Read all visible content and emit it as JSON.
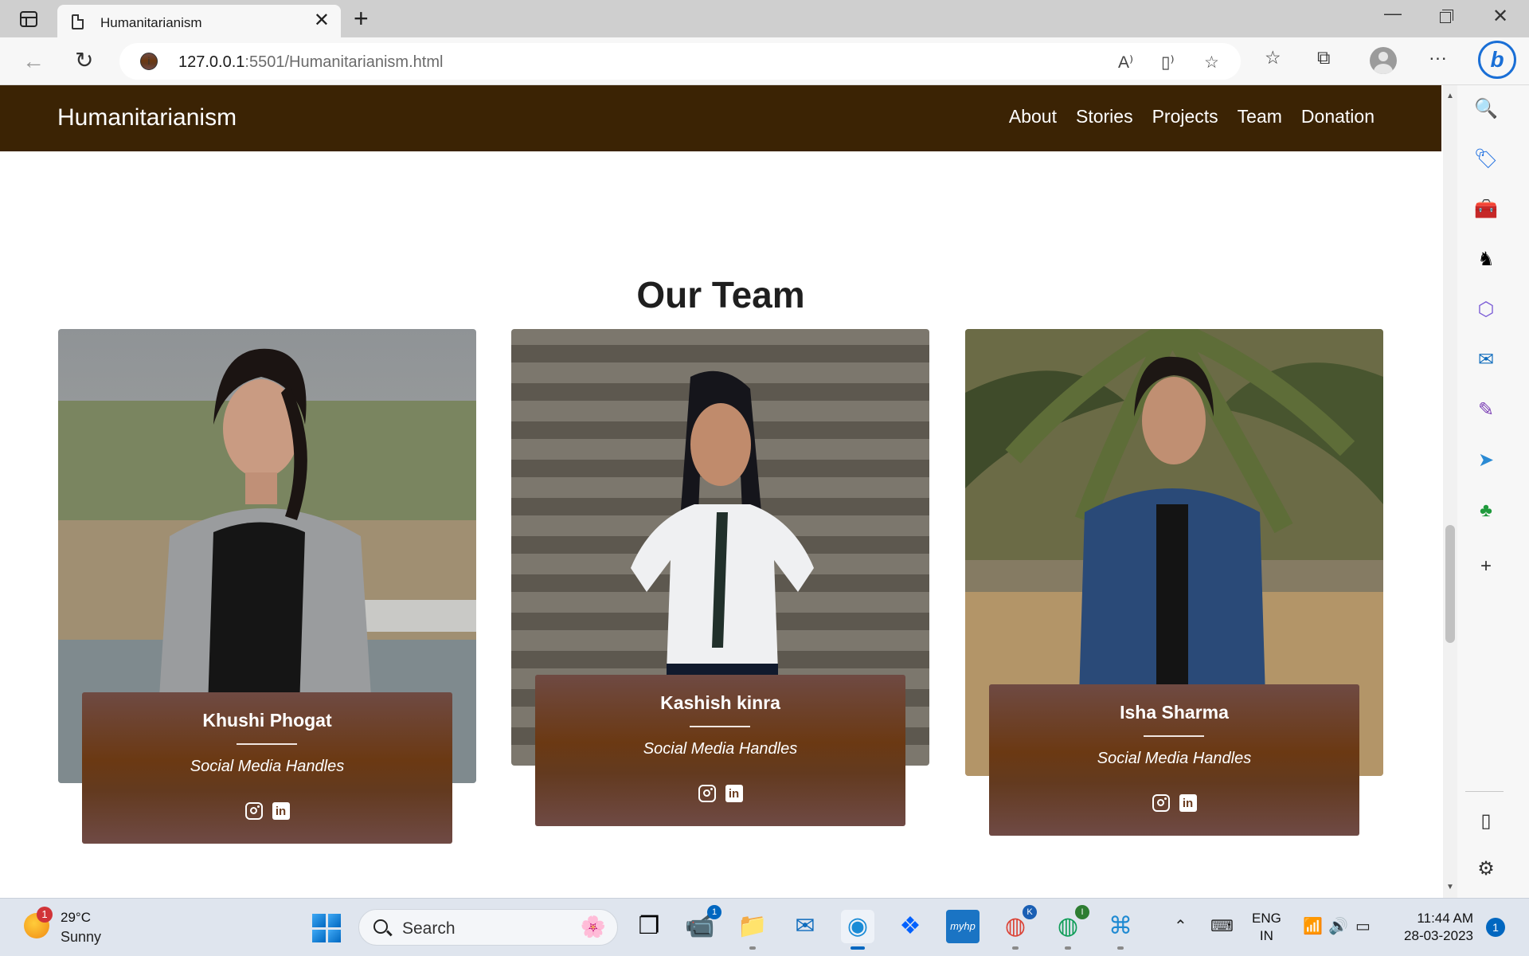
{
  "browser": {
    "tab_title": "Humanitarianism",
    "url_host": "127.0.0.1",
    "url_rest": ":5501/Humanitarianism.html"
  },
  "site": {
    "brand": "Humanitarianism",
    "nav": [
      "About",
      "Stories",
      "Projects",
      "Team",
      "Donation"
    ]
  },
  "team": {
    "title": "Our Team",
    "members": [
      {
        "name": "Khushi Phogat",
        "handles_label": "Social Media Handles"
      },
      {
        "name": "Kashish kinra",
        "handles_label": "Social Media Handles"
      },
      {
        "name": "Isha Sharma",
        "handles_label": "Social Media Handles"
      }
    ]
  },
  "taskbar": {
    "weather_badge": "1",
    "temperature": "29°C",
    "condition": "Sunny",
    "search_label": "Search",
    "teams_badge": "1",
    "chrome_profile_1": "K",
    "chrome_profile_2": "I",
    "lang_1": "ENG",
    "lang_2": "IN",
    "time": "11:44 AM",
    "date": "28-03-2023",
    "notification_count": "1"
  },
  "colors": {
    "navbar": "#3b2304",
    "card_brown": "#6b3913",
    "card_mauve": "#6f4a43",
    "edge_accent": "#1a6fd6"
  }
}
